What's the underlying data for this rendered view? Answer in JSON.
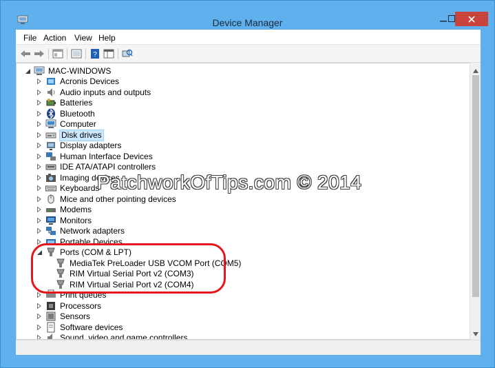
{
  "window": {
    "title": "Device Manager"
  },
  "menu": [
    "File",
    "Action",
    "View",
    "Help"
  ],
  "toolbar": [
    "back-icon",
    "forward-icon",
    "properties-view-icon",
    "device-list-icon",
    "help-icon",
    "grid-view-icon",
    "scan-hardware-icon"
  ],
  "tree": {
    "root": "MAC-WINDOWS",
    "items": [
      {
        "label": "Acronis Devices",
        "icon": "acronis-icon"
      },
      {
        "label": "Audio inputs and outputs",
        "icon": "speaker-icon"
      },
      {
        "label": "Batteries",
        "icon": "battery-icon"
      },
      {
        "label": "Bluetooth",
        "icon": "bluetooth-icon"
      },
      {
        "label": "Computer",
        "icon": "computer-icon"
      },
      {
        "label": "Disk drives",
        "icon": "disk-drive-icon",
        "selected": true
      },
      {
        "label": "Display adapters",
        "icon": "display-adapter-icon"
      },
      {
        "label": "Human Interface Devices",
        "icon": "hid-icon"
      },
      {
        "label": "IDE ATA/ATAPI controllers",
        "icon": "ide-controller-icon"
      },
      {
        "label": "Imaging devices",
        "icon": "camera-icon"
      },
      {
        "label": "Keyboards",
        "icon": "keyboard-icon"
      },
      {
        "label": "Mice and other pointing devices",
        "icon": "mouse-icon"
      },
      {
        "label": "Modems",
        "icon": "modem-icon"
      },
      {
        "label": "Monitors",
        "icon": "monitor-icon"
      },
      {
        "label": "Network adapters",
        "icon": "network-adapter-icon"
      },
      {
        "label": "Portable Devices",
        "icon": "portable-device-icon"
      },
      {
        "label": "Ports (COM & LPT)",
        "icon": "port-icon",
        "expanded": true,
        "children": [
          "MediaTek PreLoader USB VCOM Port (COM5)",
          "RIM Virtual Serial Port v2 (COM3)",
          "RIM Virtual Serial Port v2 (COM4)"
        ]
      },
      {
        "label": "Print queues",
        "icon": "printer-icon"
      },
      {
        "label": "Processors",
        "icon": "processor-icon"
      },
      {
        "label": "Sensors",
        "icon": "sensor-icon"
      },
      {
        "label": "Software devices",
        "icon": "software-device-icon"
      },
      {
        "label": "Sound, video and game controllers",
        "icon": "sound-icon"
      }
    ]
  },
  "watermark": "PatchworkOfTips.com © 2014",
  "colors": {
    "frame": "#5fb0ec",
    "close": "#c7433b",
    "selection": "#cce8ff",
    "highlight": "#e4151b"
  }
}
